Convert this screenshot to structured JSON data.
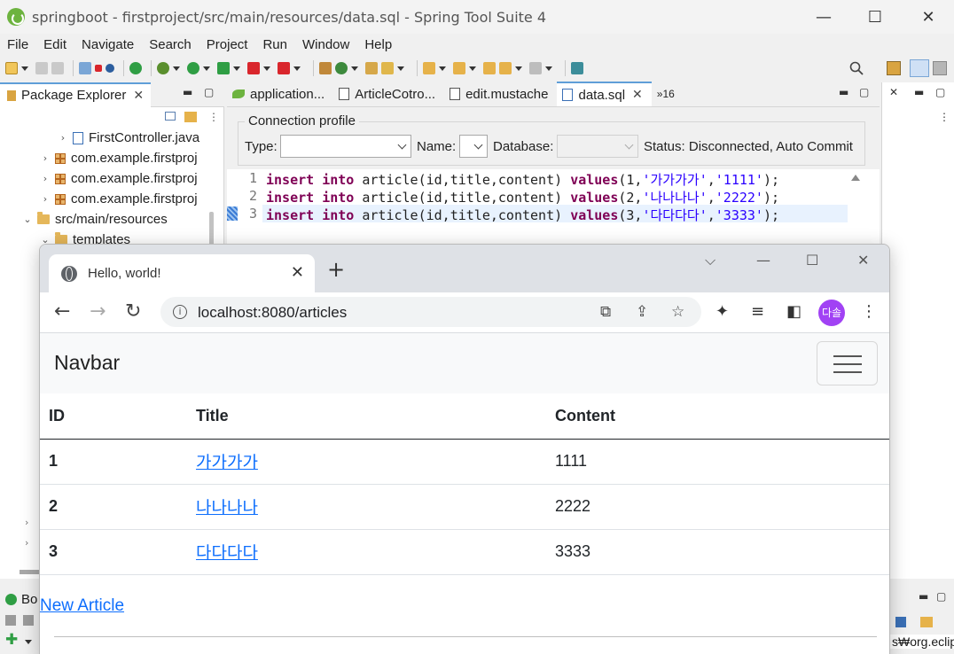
{
  "sts": {
    "title": "springboot - firstproject/src/main/resources/data.sql - Spring Tool Suite 4",
    "window_controls": {
      "minimize": "—",
      "maximize": "☐",
      "close": "✕"
    },
    "menu": [
      "File",
      "Edit",
      "Navigate",
      "Search",
      "Project",
      "Run",
      "Window",
      "Help"
    ],
    "package_explorer": {
      "tab_label": "Package Explorer",
      "tree": [
        {
          "label": "FirstController.java",
          "arrow": "›",
          "icon": "java-file-icon"
        },
        {
          "label": "com.example.firstproj",
          "arrow": "›",
          "icon": "package-icon"
        },
        {
          "label": "com.example.firstproj",
          "arrow": "›",
          "icon": "package-icon"
        },
        {
          "label": "com.example.firstproj",
          "arrow": "›",
          "icon": "package-icon"
        },
        {
          "label": "src/main/resources",
          "arrow": "⌄",
          "icon": "folder-icon"
        },
        {
          "label": "templates",
          "arrow": "⌄",
          "icon": "folder-icon"
        }
      ]
    },
    "editor": {
      "tabs": [
        {
          "label": "application...",
          "icon": "spring-leaf-icon"
        },
        {
          "label": "ArticleCotro...",
          "icon": "java-file-icon"
        },
        {
          "label": "edit.mustache",
          "icon": "file-icon"
        },
        {
          "label": "data.sql",
          "icon": "sql-file-icon"
        }
      ],
      "more_tabs": "»16",
      "connection_profile": {
        "legend": "Connection profile",
        "type_label": "Type:",
        "name_label": "Name:",
        "database_label": "Database:",
        "status": "Status: Disconnected, Auto Commit"
      },
      "sql_lines": [
        {
          "no": "1",
          "kw1": "insert",
          "kw2": "into",
          "mid": " article(id,title,content) ",
          "kw3": "values",
          "open": "(1,",
          "s1": "'가가가가'",
          "comma": ",",
          "s2": "'1111'",
          "close": ");"
        },
        {
          "no": "2",
          "kw1": "insert",
          "kw2": "into",
          "mid": " article(id,title,content) ",
          "kw3": "values",
          "open": "(2,",
          "s1": "'나나나나'",
          "comma": ",",
          "s2": "'2222'",
          "close": ");"
        },
        {
          "no": "3",
          "kw1": "insert",
          "kw2": "into",
          "mid": " article(id,title,content) ",
          "kw3": "values",
          "open": "(3,",
          "s1": "'다다다다'",
          "comma": ",",
          "s2": "'3333'",
          "close": ");"
        }
      ]
    },
    "bottom_panel_label": "Bo",
    "bottom_right_text": "s₩org.eclip"
  },
  "browser": {
    "tab_title": "Hello, world!",
    "url": "localhost:8080/articles",
    "profile_initials": "다솔",
    "page": {
      "navbar_brand": "Navbar",
      "table": {
        "headers": [
          "ID",
          "Title",
          "Content"
        ],
        "rows": [
          {
            "id": "1",
            "title": "가가가가",
            "content": "1111"
          },
          {
            "id": "2",
            "title": "나나나나",
            "content": "2222"
          },
          {
            "id": "3",
            "title": "다다다다",
            "content": "3333"
          }
        ]
      },
      "new_article_link": "New Article"
    }
  },
  "colors": {
    "keyword": "#7f0055",
    "string": "#2a00ff",
    "link": "#0d6efd",
    "navbar_bg": "#f8f9fa",
    "profile": "#a142f4",
    "spring_green": "#6db33f"
  }
}
